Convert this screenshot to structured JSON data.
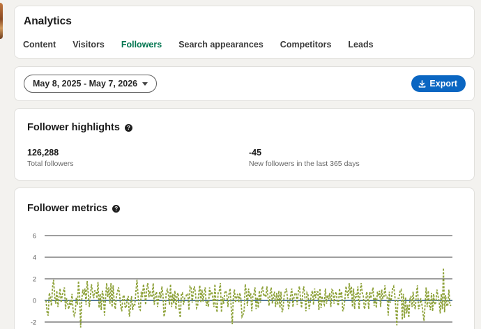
{
  "header": {
    "title": "Analytics",
    "tabs": [
      {
        "label": "Content",
        "active": false
      },
      {
        "label": "Visitors",
        "active": false
      },
      {
        "label": "Followers",
        "active": true
      },
      {
        "label": "Search appearances",
        "active": false
      },
      {
        "label": "Competitors",
        "active": false
      },
      {
        "label": "Leads",
        "active": false
      }
    ]
  },
  "toolbar": {
    "date_range": "May 8, 2025 - May 7, 2026",
    "export_label": "Export",
    "export_icon": "download-icon"
  },
  "highlights": {
    "title": "Follower highlights",
    "help_icon": "help-icon",
    "total_value": "126,288",
    "total_label": "Total followers",
    "new_value": "-45",
    "new_label": "New followers in the last 365 days"
  },
  "metrics": {
    "title": "Follower metrics",
    "help_icon": "help-icon"
  },
  "colors": {
    "accent_green": "#01754f",
    "button_blue": "#0a66c2",
    "series_green": "#8ea23a",
    "zero_line": "#1f4e79"
  },
  "chart_data": {
    "type": "line",
    "title": "",
    "xlabel": "",
    "ylabel": "",
    "ylim": [
      -2,
      6
    ],
    "yticks": [
      6,
      4,
      2,
      0,
      -2
    ],
    "grid": true,
    "series": [
      {
        "name": "",
        "line_style": "dashed",
        "values": [
          0,
          -1.1,
          -1.4,
          0.7,
          0.3,
          -0.5,
          1.2,
          1.9,
          0.4,
          -0.3,
          0.9,
          -0.6,
          0.3,
          1.1,
          -0.2,
          0.5,
          0.8,
          1.2,
          -0.8,
          0.2,
          -0.3,
          -0.8,
          0,
          -0.5,
          0.6,
          -0.9,
          -1.4,
          -1.1,
          0.3,
          -0.4,
          1.8,
          0.4,
          -2.5,
          0.1,
          1.0,
          0.5,
          1.1,
          -0.4,
          1.8,
          0.7,
          -0.6,
          0.4,
          1.5,
          0.7,
          0.2,
          0.9,
          0.9,
          0.2,
          1.7,
          -0.7,
          0.6,
          -0.9,
          0.9,
          0.4,
          -1.4,
          0.2,
          1.6,
          0.3,
          1.2,
          -0.3,
          1.6,
          -0.6,
          1.4,
          -0.2,
          -0.8,
          0.4,
          0.8,
          1.2,
          0.5,
          -0.6,
          -1.0,
          0.3,
          0.5,
          -0.6,
          -0.7,
          0.1,
          0.4,
          -1.5,
          -0.6,
          0.4,
          -0.9,
          -0.3,
          -0.4,
          0.8,
          1.9,
          0.5,
          -0.8,
          -0.9,
          0.8,
          0.3,
          1.5,
          0.8,
          -0.4,
          1.1,
          1.6,
          0.3,
          0.9,
          0.3,
          0.4,
          1.6,
          -0.4,
          0.5,
          0.8,
          -0.6,
          0.2,
          0.8,
          0.2,
          1.3,
          0.5,
          -1.5,
          -1.0,
          0.7,
          1.0,
          0.6,
          -0.4,
          1.5,
          -0.6,
          0.6,
          -0.3,
          0.9,
          -0.8,
          0.5,
          0.7,
          -0.9,
          -1.6,
          0.6,
          0.7,
          -0.4,
          0.2,
          0.3,
          0.6,
          0.6,
          -0.9,
          1.3,
          1.2,
          -0.2,
          0.8,
          1.3,
          0.7,
          -0.7,
          -0.5,
          0.6,
          1.4,
          -0.2,
          1.0,
          -0.1,
          0.7,
          1.2,
          -0.5,
          -0.2,
          -0.6,
          1.2,
          0.6,
          0.8,
          0.3,
          -0.6,
          1.5,
          -0.5,
          -1.1,
          0.8,
          0.9,
          1.6,
          -1.1,
          0.3,
          -0.3,
          0.7,
          0.9,
          0.5,
          -0.6,
          0.6,
          1.1,
          -0.6,
          -2.2,
          0.4,
          1.0,
          -0.2,
          0.3,
          0.6,
          -0.2,
          0.7,
          0.1,
          -1.5,
          -1.3,
          -0.9,
          1.5,
          0.7,
          -0.5,
          1.1,
          0.3,
          0.7,
          -1.0,
          0.4,
          0.6,
          1.2,
          -0.8,
          0.3,
          -0.7,
          0.9,
          -0.2,
          0.9,
          1.3,
          0.4,
          0.5,
          0.3,
          1.3,
          0.3,
          -0.5,
          0.7,
          1.2,
          -0.3,
          0.4,
          0.8,
          -0.6,
          0.7,
          -0.4,
          0.9,
          -0.7,
          0.8,
          -1.1,
          -0.7,
          0.6,
          0.8,
          1.1,
          0.2,
          -0.8,
          -0.2,
          0.6,
          1.1,
          -0.6,
          0.3,
          0.7,
          0.6,
          -0.4,
          0.9,
          1.3,
          0.2,
          -0.7,
          0.6,
          1.3,
          0.4,
          -1.0,
          0.7,
          0.5,
          -0.8,
          -0.2,
          0.6,
          0.9,
          -0.4,
          1.1,
          0.2,
          0.8,
          0.8,
          -0.9,
          1.1,
          -0.7,
          0.4,
          -0.2,
          -0.4,
          1.1,
          -0.3,
          0.5,
          0.1,
          0.7,
          -0.6,
          1.0,
          0.9,
          -0.3,
          0.6,
          0.8,
          -0.2,
          -0.5,
          1.1,
          0.3,
          0.8,
          -1.0,
          -0.7,
          0.1,
          1.3,
          0.8,
          0.2,
          1.6,
          0.6,
          1.3,
          -0.6,
          1.1,
          -0.8,
          0.6,
          0.3,
          1.3,
          -0.8,
          0.6,
          1.6,
          0.7,
          0.4,
          -0.8,
          -0.5,
          0.8,
          0.5,
          -0.8,
          0.8,
          0.2,
          0.7,
          1.2,
          -0.5,
          0.3,
          -0.7,
          0.8,
          0.4,
          0.9,
          -0.6,
          1.0,
          0.2,
          0.3,
          1.4,
          0.3,
          0.3,
          -1.4,
          0.8,
          -0.2,
          0.2,
          1.1,
          1.3,
          0.6,
          -0.7,
          -2.3,
          0.2,
          0.2,
          0.9,
          1.0,
          -1.8,
          0.6,
          -1.6,
          0.3,
          -1.2,
          -0.4,
          -1.6,
          0.1,
          0.4,
          -0.6,
          0.8,
          -0.5,
          -0.8,
          0.6,
          1.4,
          -0.8,
          -0.6,
          0.2,
          -0.3,
          -1.1,
          -1.9,
          -0.5,
          1.2,
          -0.6,
          0.9,
          -0.5,
          -0.9,
          0.7,
          -1.0,
          0.6,
          -0.4,
          -0.2,
          1.0,
          0.4,
          -0.1,
          -1.2,
          0.6,
          -0.8,
          3.0,
          -1.1,
          0.5,
          -0.5,
          -0.5,
          1.0,
          -0.4,
          -0.5
        ]
      }
    ]
  }
}
